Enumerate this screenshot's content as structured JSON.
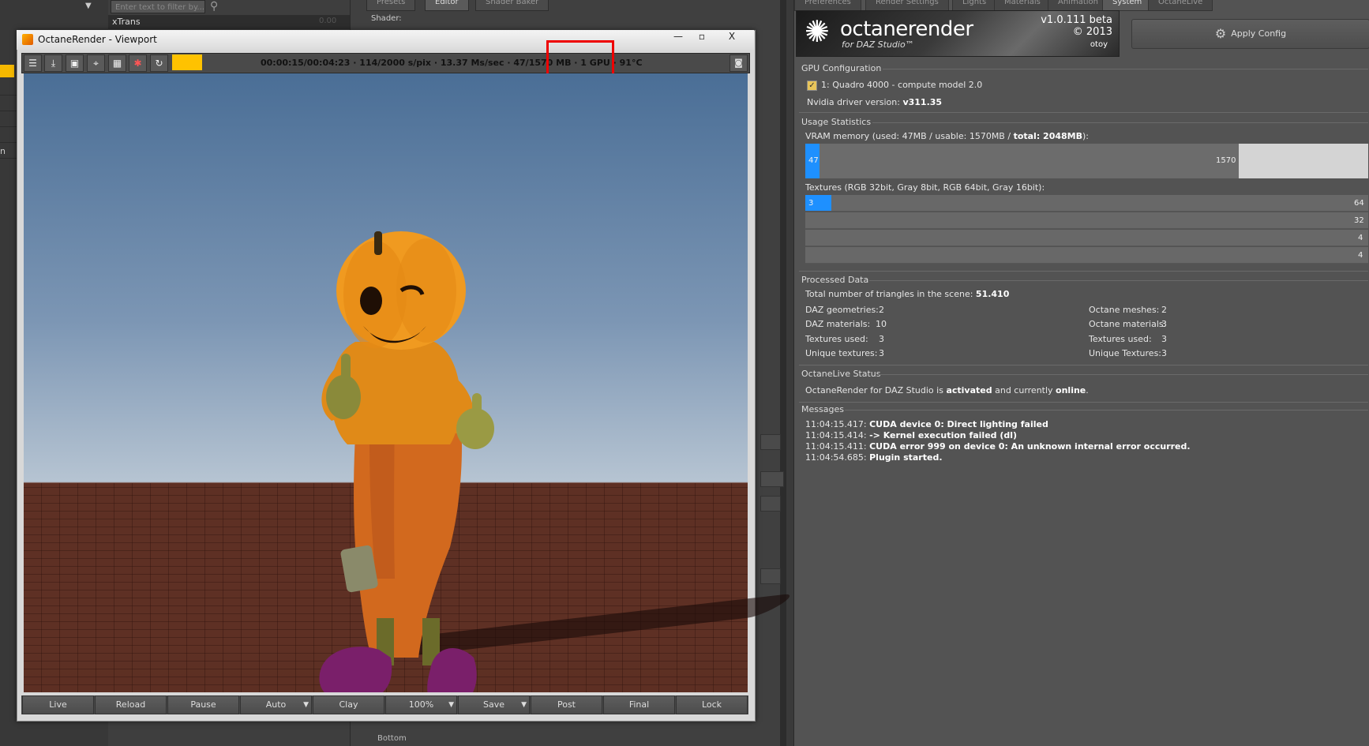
{
  "background": {
    "filter_placeholder": "Enter text to filter by...",
    "xtrans_label": "xTrans",
    "xtrans_value": "0.00",
    "left_cut_text": "n",
    "editor_tabs": [
      "Presets",
      "Editor",
      "Shader Baker"
    ],
    "shader_label": "Shader:",
    "bottom_label": "Bottom"
  },
  "viewport": {
    "title": "OctaneRender - Viewport",
    "status": "00:00:15/00:04:23 · 114/2000 s/pix · 13.37 Ms/sec · 47/1570 MB · 1 GPU · 91°C",
    "toolbar_icons": [
      "menu-icon",
      "import-icon",
      "frame-icon",
      "target-icon",
      "grid-icon",
      "color-wheel-icon",
      "refresh-icon"
    ],
    "window_buttons": {
      "minimize": "—",
      "restore": "▫",
      "close": "X"
    },
    "camera_icon": "camera-icon",
    "buttons": [
      {
        "label": "Live",
        "dropdown": false
      },
      {
        "label": "Reload",
        "dropdown": false
      },
      {
        "label": "Pause",
        "dropdown": false
      },
      {
        "label": "Auto",
        "dropdown": true
      },
      {
        "label": "Clay",
        "dropdown": false
      },
      {
        "label": "100%",
        "dropdown": true
      },
      {
        "label": "Save",
        "dropdown": true
      },
      {
        "label": "Post",
        "dropdown": false
      },
      {
        "label": "Final",
        "dropdown": false
      },
      {
        "label": "Lock",
        "dropdown": false
      }
    ],
    "highlight_color": "#e00000"
  },
  "right_panel": {
    "tabs": [
      "Preferences",
      "Render Settings",
      "Lights",
      "Materials",
      "Animation",
      "System",
      "OctaneLive"
    ],
    "active_tab": "System",
    "logo": {
      "brand": "octanerender",
      "sub": "for DAZ Studio™",
      "version": "v1.0.111 beta",
      "copyright": "© 2013",
      "maker": "otoy"
    },
    "apply_config": "Apply Config",
    "gpu_config": {
      "header": "GPU Configuration",
      "device": "1: Quadro 4000 - compute model 2.0",
      "driver_label": "Nvidia driver version:",
      "driver_value": "v311.35"
    },
    "usage": {
      "header": "Usage Statistics",
      "vram_label": "VRAM memory (used: 47MB / usable: 1570MB / ",
      "vram_total": "total: 2048MB",
      "vram_close": "):",
      "vram_used": 47,
      "vram_usable": 1570,
      "vram_total_mb": 2048,
      "vram_used_label": "47",
      "vram_usable_label": "1570",
      "textures_label": "Textures (RGB 32bit, Gray 8bit, RGB 64bit, Gray 16bit):",
      "textures_used_label": "3",
      "texture_rows": [
        "64",
        "32",
        "4",
        "4"
      ]
    },
    "processed": {
      "header": "Processed Data",
      "triangles_label": "Total number of triangles in the scene:",
      "triangles_value": "51.410",
      "left": [
        {
          "label": "DAZ geometries:",
          "value": "2"
        },
        {
          "label": "DAZ materials:",
          "value": "10"
        },
        {
          "label": "Textures used:",
          "value": "3"
        },
        {
          "label": "Unique textures:",
          "value": "3"
        }
      ],
      "right": [
        {
          "label": "Octane meshes:",
          "value": "2"
        },
        {
          "label": "Octane materials:",
          "value": "3"
        },
        {
          "label": "Textures used:",
          "value": "3"
        },
        {
          "label": "Unique Textures:",
          "value": "3"
        }
      ]
    },
    "live": {
      "header": "OctaneLive Status",
      "text_a": "OctaneRender for DAZ Studio is ",
      "bold_a": "activated",
      "text_b": " and currently ",
      "bold_b": "online",
      "text_c": "."
    },
    "messages": {
      "header": "Messages",
      "items": [
        {
          "time": "11:04:15.417: ",
          "text": "CUDA device 0: Direct lighting failed"
        },
        {
          "time": "11:04:15.414: ",
          "text": "-> Kernel execution failed (dl)"
        },
        {
          "time": "11:04:15.411: ",
          "text": "CUDA error 999 on device 0: An unknown internal error occurred."
        },
        {
          "time": "11:04:54.685: ",
          "text": "Plugin started."
        }
      ]
    }
  }
}
